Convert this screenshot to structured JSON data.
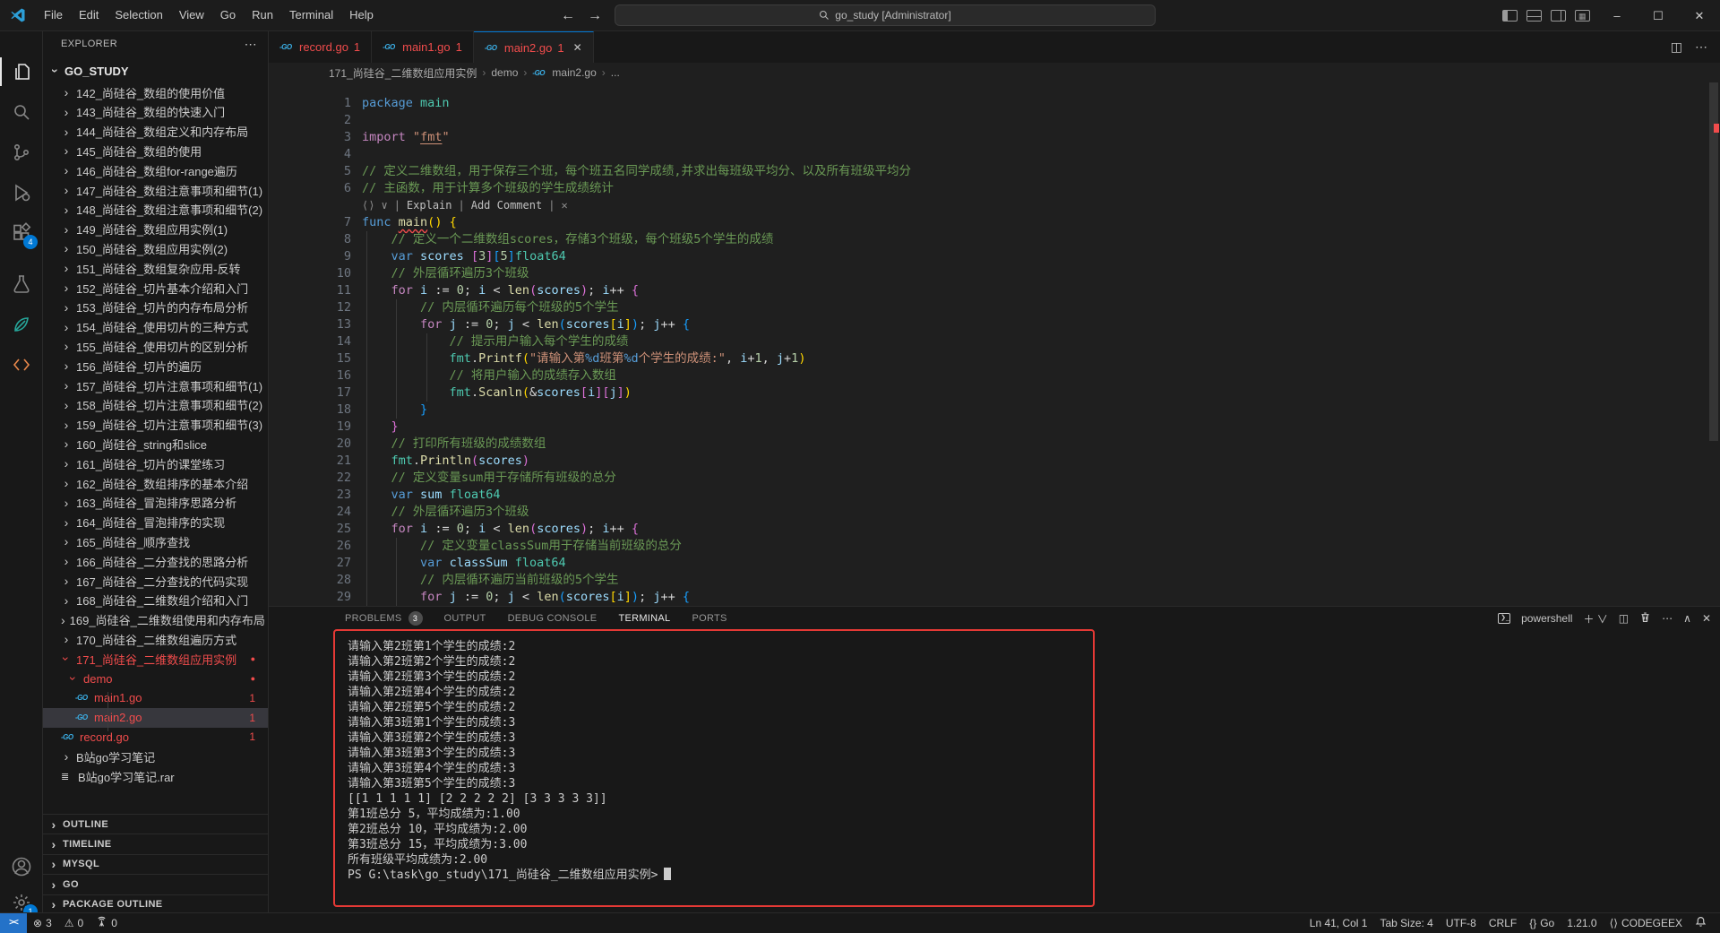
{
  "window": {
    "menus": [
      "File",
      "Edit",
      "Selection",
      "View",
      "Go",
      "Run",
      "Terminal",
      "Help"
    ],
    "search_value": "go_study [Administrator]",
    "controls": {
      "minimize": "–",
      "maximize": "☐",
      "close": "✕"
    },
    "nav": {
      "back": "←",
      "forward": "→"
    }
  },
  "activity_bar": {
    "extensions_badge": "4",
    "settings_badge": "1"
  },
  "sidebar": {
    "title": "EXPLORER",
    "more": "⋯",
    "root": "GO_STUDY",
    "items": [
      {
        "label": "142_尚硅谷_数组的使用价值",
        "lvl": 0,
        "chev": "c"
      },
      {
        "label": "143_尚硅谷_数组的快速入门",
        "lvl": 0,
        "chev": "c"
      },
      {
        "label": "144_尚硅谷_数组定义和内存布局",
        "lvl": 0,
        "chev": "c"
      },
      {
        "label": "145_尚硅谷_数组的使用",
        "lvl": 0,
        "chev": "c"
      },
      {
        "label": "146_尚硅谷_数组for-range遍历",
        "lvl": 0,
        "chev": "c"
      },
      {
        "label": "147_尚硅谷_数组注意事项和细节(1)",
        "lvl": 0,
        "chev": "c"
      },
      {
        "label": "148_尚硅谷_数组注意事项和细节(2)",
        "lvl": 0,
        "chev": "c"
      },
      {
        "label": "149_尚硅谷_数组应用实例(1)",
        "lvl": 0,
        "chev": "c"
      },
      {
        "label": "150_尚硅谷_数组应用实例(2)",
        "lvl": 0,
        "chev": "c"
      },
      {
        "label": "151_尚硅谷_数组复杂应用-反转",
        "lvl": 0,
        "chev": "c"
      },
      {
        "label": "152_尚硅谷_切片基本介绍和入门",
        "lvl": 0,
        "chev": "c"
      },
      {
        "label": "153_尚硅谷_切片的内存布局分析",
        "lvl": 0,
        "chev": "c"
      },
      {
        "label": "154_尚硅谷_使用切片的三种方式",
        "lvl": 0,
        "chev": "c"
      },
      {
        "label": "155_尚硅谷_使用切片的区别分析",
        "lvl": 0,
        "chev": "c"
      },
      {
        "label": "156_尚硅谷_切片的遍历",
        "lvl": 0,
        "chev": "c"
      },
      {
        "label": "157_尚硅谷_切片注意事项和细节(1)",
        "lvl": 0,
        "chev": "c"
      },
      {
        "label": "158_尚硅谷_切片注意事项和细节(2)",
        "lvl": 0,
        "chev": "c"
      },
      {
        "label": "159_尚硅谷_切片注意事项和细节(3)",
        "lvl": 0,
        "chev": "c"
      },
      {
        "label": "160_尚硅谷_string和slice",
        "lvl": 0,
        "chev": "c"
      },
      {
        "label": "161_尚硅谷_切片的课堂练习",
        "lvl": 0,
        "chev": "c"
      },
      {
        "label": "162_尚硅谷_数组排序的基本介绍",
        "lvl": 0,
        "chev": "c"
      },
      {
        "label": "163_尚硅谷_冒泡排序思路分析",
        "lvl": 0,
        "chev": "c"
      },
      {
        "label": "164_尚硅谷_冒泡排序的实现",
        "lvl": 0,
        "chev": "c"
      },
      {
        "label": "165_尚硅谷_顺序查找",
        "lvl": 0,
        "chev": "c"
      },
      {
        "label": "166_尚硅谷_二分查找的思路分析",
        "lvl": 0,
        "chev": "c"
      },
      {
        "label": "167_尚硅谷_二分查找的代码实现",
        "lvl": 0,
        "chev": "c"
      },
      {
        "label": "168_尚硅谷_二维数组介绍和入门",
        "lvl": 0,
        "chev": "c"
      },
      {
        "label": "169_尚硅谷_二维数组使用和内存布局",
        "lvl": 0,
        "chev": "c"
      },
      {
        "label": "170_尚硅谷_二维数组遍历方式",
        "lvl": 0,
        "chev": "c"
      },
      {
        "label": "171_尚硅谷_二维数组应用实例",
        "lvl": 0,
        "chev": "o",
        "red": true,
        "dot": "●"
      },
      {
        "label": "demo",
        "lvl": 1,
        "chev": "o",
        "red": true,
        "dot": "●"
      },
      {
        "label": "main1.go",
        "lvl": 2,
        "icon": "go",
        "red": true,
        "badge": "1"
      },
      {
        "label": "main2.go",
        "lvl": 2,
        "icon": "go",
        "red": true,
        "badge": "1",
        "sel": true
      },
      {
        "label": "record.go",
        "lvl": 0,
        "icon": "go",
        "red": true,
        "badge": "1"
      },
      {
        "label": "B站go学习笔记",
        "lvl": 0,
        "chev": "c"
      },
      {
        "label": "B站go学习笔记.rar",
        "lvl": 0,
        "icon": "rar"
      }
    ],
    "sections": [
      "OUTLINE",
      "TIMELINE",
      "MYSQL",
      "GO",
      "PACKAGE OUTLINE"
    ]
  },
  "tabs": [
    {
      "name": "record.go",
      "badge": "1",
      "active": false
    },
    {
      "name": "main1.go",
      "badge": "1",
      "active": false
    },
    {
      "name": "main2.go",
      "badge": "1",
      "active": true,
      "close": "✕"
    }
  ],
  "breadcrumb": [
    "171_尚硅谷_二维数组应用实例",
    "demo",
    "main2.go",
    "..."
  ],
  "editor": {
    "widget": {
      "after_line": 6,
      "icon": "⟨⟩",
      "chevron": "∨",
      "actions": [
        "Explain",
        "Add Comment"
      ],
      "close": "✕"
    },
    "lines": [
      {
        "n": 1,
        "t": [
          [
            "package",
            "kb"
          ],
          [
            " ",
            "pl"
          ],
          [
            "main",
            "ns"
          ]
        ]
      },
      {
        "n": 2,
        "t": []
      },
      {
        "n": 3,
        "t": [
          [
            "import",
            "kc"
          ],
          [
            " ",
            "pl"
          ],
          [
            "\"",
            "st"
          ],
          [
            "fmt",
            "stu"
          ],
          [
            "\"",
            "st"
          ]
        ]
      },
      {
        "n": 4,
        "t": []
      },
      {
        "n": 5,
        "t": [
          [
            "// 定义二维数组，用于保存三个班，每个班五名同学成绩,并求出每班级平均分、以及所有班级平均分",
            "cm"
          ]
        ]
      },
      {
        "n": 6,
        "t": [
          [
            "// 主函数，用于计算多个班级的学生成绩统计",
            "cm"
          ]
        ]
      },
      {
        "n": 7,
        "t": [
          [
            "func",
            "kb"
          ],
          [
            " ",
            "pl"
          ],
          [
            "main",
            "fn sq"
          ],
          [
            "(",
            "b1"
          ],
          [
            ")",
            "b1"
          ],
          [
            " ",
            "pl"
          ],
          [
            "{",
            "b1"
          ]
        ]
      },
      {
        "n": 8,
        "t": [
          [
            "    // 定义一个二维数组scores，存储3个班级，每个班级5个学生的成绩",
            "cm"
          ]
        ]
      },
      {
        "n": 9,
        "t": [
          [
            "    ",
            "pl"
          ],
          [
            "var",
            "kb"
          ],
          [
            " ",
            "pl"
          ],
          [
            "scores",
            "vr"
          ],
          [
            " ",
            "pl"
          ],
          [
            "[",
            "b2"
          ],
          [
            "3",
            "nm"
          ],
          [
            "]",
            "b2"
          ],
          [
            "[",
            "b3"
          ],
          [
            "5",
            "nm"
          ],
          [
            "]",
            "b3"
          ],
          [
            "float64",
            "ns"
          ]
        ]
      },
      {
        "n": 10,
        "t": [
          [
            "    // 外层循环遍历3个班级",
            "cm"
          ]
        ]
      },
      {
        "n": 11,
        "t": [
          [
            "    ",
            "pl"
          ],
          [
            "for",
            "kc"
          ],
          [
            " ",
            "pl"
          ],
          [
            "i",
            "vr"
          ],
          [
            " ",
            "pl"
          ],
          [
            ":=",
            "pl"
          ],
          [
            " ",
            "pl"
          ],
          [
            "0",
            "nm"
          ],
          [
            "; ",
            "pl"
          ],
          [
            "i",
            "vr"
          ],
          [
            " < ",
            "pl"
          ],
          [
            "len",
            "fn"
          ],
          [
            "(",
            "b2"
          ],
          [
            "scores",
            "vr"
          ],
          [
            ")",
            "b2"
          ],
          [
            "; ",
            "pl"
          ],
          [
            "i",
            "vr"
          ],
          [
            "++ ",
            "pl"
          ],
          [
            "{",
            "b2"
          ]
        ]
      },
      {
        "n": 12,
        "t": [
          [
            "        // 内层循环遍历每个班级的5个学生",
            "cm"
          ]
        ]
      },
      {
        "n": 13,
        "t": [
          [
            "        ",
            "pl"
          ],
          [
            "for",
            "kc"
          ],
          [
            " ",
            "pl"
          ],
          [
            "j",
            "vr"
          ],
          [
            " ",
            "pl"
          ],
          [
            ":=",
            "pl"
          ],
          [
            " ",
            "pl"
          ],
          [
            "0",
            "nm"
          ],
          [
            "; ",
            "pl"
          ],
          [
            "j",
            "vr"
          ],
          [
            " < ",
            "pl"
          ],
          [
            "len",
            "fn"
          ],
          [
            "(",
            "b3"
          ],
          [
            "scores",
            "vr"
          ],
          [
            "[",
            "b1"
          ],
          [
            "i",
            "vr"
          ],
          [
            "]",
            "b1"
          ],
          [
            ")",
            "b3"
          ],
          [
            "; ",
            "pl"
          ],
          [
            "j",
            "vr"
          ],
          [
            "++ ",
            "pl"
          ],
          [
            "{",
            "b3"
          ]
        ]
      },
      {
        "n": 14,
        "t": [
          [
            "            // 提示用户输入每个学生的成绩",
            "cm"
          ]
        ]
      },
      {
        "n": 15,
        "t": [
          [
            "            ",
            "pl"
          ],
          [
            "fmt",
            "ns"
          ],
          [
            ".",
            "pl"
          ],
          [
            "Printf",
            "fn"
          ],
          [
            "(",
            "b1"
          ],
          [
            "\"请输入第",
            "st"
          ],
          [
            "%d",
            "fs"
          ],
          [
            "班第",
            "st"
          ],
          [
            "%d",
            "fs"
          ],
          [
            "个学生的成绩:\"",
            "st"
          ],
          [
            ", ",
            "pl"
          ],
          [
            "i",
            "vr"
          ],
          [
            "+",
            "pl"
          ],
          [
            "1",
            "nm"
          ],
          [
            ", ",
            "pl"
          ],
          [
            "j",
            "vr"
          ],
          [
            "+",
            "pl"
          ],
          [
            "1",
            "nm"
          ],
          [
            ")",
            "b1"
          ]
        ]
      },
      {
        "n": 16,
        "t": [
          [
            "            // 将用户输入的成绩存入数组",
            "cm"
          ]
        ]
      },
      {
        "n": 17,
        "t": [
          [
            "            ",
            "pl"
          ],
          [
            "fmt",
            "ns"
          ],
          [
            ".",
            "pl"
          ],
          [
            "Scanln",
            "fn"
          ],
          [
            "(",
            "b1"
          ],
          [
            "&",
            "pl"
          ],
          [
            "scores",
            "vr"
          ],
          [
            "[",
            "b2"
          ],
          [
            "i",
            "vr"
          ],
          [
            "]",
            "b2"
          ],
          [
            "[",
            "b2"
          ],
          [
            "j",
            "vr"
          ],
          [
            "]",
            "b2"
          ],
          [
            ")",
            "b1"
          ]
        ]
      },
      {
        "n": 18,
        "t": [
          [
            "        ",
            "pl"
          ],
          [
            "}",
            "b3"
          ]
        ]
      },
      {
        "n": 19,
        "t": [
          [
            "    ",
            "pl"
          ],
          [
            "}",
            "b2"
          ]
        ]
      },
      {
        "n": 20,
        "t": [
          [
            "    // 打印所有班级的成绩数组",
            "cm"
          ]
        ]
      },
      {
        "n": 21,
        "t": [
          [
            "    ",
            "pl"
          ],
          [
            "fmt",
            "ns"
          ],
          [
            ".",
            "pl"
          ],
          [
            "Println",
            "fn"
          ],
          [
            "(",
            "b2"
          ],
          [
            "scores",
            "vr"
          ],
          [
            ")",
            "b2"
          ]
        ]
      },
      {
        "n": 22,
        "t": [
          [
            "    // 定义变量sum用于存储所有班级的总分",
            "cm"
          ]
        ]
      },
      {
        "n": 23,
        "t": [
          [
            "    ",
            "pl"
          ],
          [
            "var",
            "kb"
          ],
          [
            " ",
            "pl"
          ],
          [
            "sum",
            "vr"
          ],
          [
            " ",
            "pl"
          ],
          [
            "float64",
            "ns"
          ]
        ]
      },
      {
        "n": 24,
        "t": [
          [
            "    // 外层循环遍历3个班级",
            "cm"
          ]
        ]
      },
      {
        "n": 25,
        "t": [
          [
            "    ",
            "pl"
          ],
          [
            "for",
            "kc"
          ],
          [
            " ",
            "pl"
          ],
          [
            "i",
            "vr"
          ],
          [
            " ",
            "pl"
          ],
          [
            ":=",
            "pl"
          ],
          [
            " ",
            "pl"
          ],
          [
            "0",
            "nm"
          ],
          [
            "; ",
            "pl"
          ],
          [
            "i",
            "vr"
          ],
          [
            " < ",
            "pl"
          ],
          [
            "len",
            "fn"
          ],
          [
            "(",
            "b2"
          ],
          [
            "scores",
            "vr"
          ],
          [
            ")",
            "b2"
          ],
          [
            "; ",
            "pl"
          ],
          [
            "i",
            "vr"
          ],
          [
            "++ ",
            "pl"
          ],
          [
            "{",
            "b2"
          ]
        ]
      },
      {
        "n": 26,
        "t": [
          [
            "        // 定义变量classSum用于存储当前班级的总分",
            "cm"
          ]
        ]
      },
      {
        "n": 27,
        "t": [
          [
            "        ",
            "pl"
          ],
          [
            "var",
            "kb"
          ],
          [
            " ",
            "pl"
          ],
          [
            "classSum",
            "vr"
          ],
          [
            " ",
            "pl"
          ],
          [
            "float64",
            "ns"
          ]
        ]
      },
      {
        "n": 28,
        "t": [
          [
            "        // 内层循环遍历当前班级的5个学生",
            "cm"
          ]
        ]
      },
      {
        "n": 29,
        "t": [
          [
            "        ",
            "pl"
          ],
          [
            "for",
            "kc"
          ],
          [
            " ",
            "pl"
          ],
          [
            "j",
            "vr"
          ],
          [
            " ",
            "pl"
          ],
          [
            ":=",
            "pl"
          ],
          [
            " ",
            "pl"
          ],
          [
            "0",
            "nm"
          ],
          [
            "; ",
            "pl"
          ],
          [
            "j",
            "vr"
          ],
          [
            " < ",
            "pl"
          ],
          [
            "len",
            "fn"
          ],
          [
            "(",
            "b3"
          ],
          [
            "scores",
            "vr"
          ],
          [
            "[",
            "b1"
          ],
          [
            "i",
            "vr"
          ],
          [
            "]",
            "b1"
          ],
          [
            ")",
            "b3"
          ],
          [
            "; ",
            "pl"
          ],
          [
            "j",
            "vr"
          ],
          [
            "++ ",
            "pl"
          ],
          [
            "{",
            "b3"
          ]
        ]
      }
    ]
  },
  "panel": {
    "tabs": [
      {
        "label": "PROBLEMS",
        "badge": "3",
        "active": false
      },
      {
        "label": "OUTPUT",
        "active": false
      },
      {
        "label": "DEBUG CONSOLE",
        "active": false
      },
      {
        "label": "TERMINAL",
        "active": true
      },
      {
        "label": "PORTS",
        "active": false
      }
    ],
    "terminal_name": "powershell",
    "action_glyphs": [
      "＋ ∨",
      "◫",
      "trash",
      "⋯",
      "∧",
      "✕"
    ]
  },
  "terminal": {
    "lines": [
      "请输入第2班第1个学生的成绩:2",
      "请输入第2班第2个学生的成绩:2",
      "请输入第2班第3个学生的成绩:2",
      "请输入第2班第4个学生的成绩:2",
      "请输入第2班第5个学生的成绩:2",
      "请输入第3班第1个学生的成绩:3",
      "请输入第3班第2个学生的成绩:3",
      "请输入第3班第3个学生的成绩:3",
      "请输入第3班第4个学生的成绩:3",
      "请输入第3班第5个学生的成绩:3",
      "[[1 1 1 1 1] [2 2 2 2 2] [3 3 3 3 3]]",
      "第1班总分 5，平均成绩为:1.00",
      "第2班总分 10，平均成绩为:2.00",
      "第3班总分 15，平均成绩为:3.00",
      "所有班级平均成绩为:2.00"
    ],
    "prompt": "PS G:\\task\\go_study\\171_尚硅谷_二维数组应用实例>"
  },
  "status_bar": {
    "remote": "><",
    "left": [
      {
        "icon": "error-icon",
        "glyph": "⊗",
        "text": "3"
      },
      {
        "icon": "warning-icon",
        "glyph": "⚠",
        "text": "0"
      },
      {
        "icon": "tower-icon",
        "glyph": "tower",
        "text": "0"
      }
    ],
    "right": [
      {
        "text": "Ln 41, Col 1"
      },
      {
        "text": "Tab Size: 4"
      },
      {
        "text": "UTF-8"
      },
      {
        "text": "CRLF"
      },
      {
        "icon": "go-lang-icon",
        "glyph": "{}",
        "text": "Go"
      },
      {
        "text": "1.21.0"
      },
      {
        "icon": "codegeex-icon",
        "glyph": "⟨⟩",
        "text": "CODEGEEX"
      },
      {
        "icon": "bell-icon",
        "glyph": "bell",
        "text": ""
      }
    ]
  },
  "colors": {
    "accent_blue": "#0078d4",
    "error_red": "#f14c4c",
    "annotation_red": "#e53935",
    "editor_bg": "#1f1f1f",
    "chrome_bg": "#181818"
  }
}
